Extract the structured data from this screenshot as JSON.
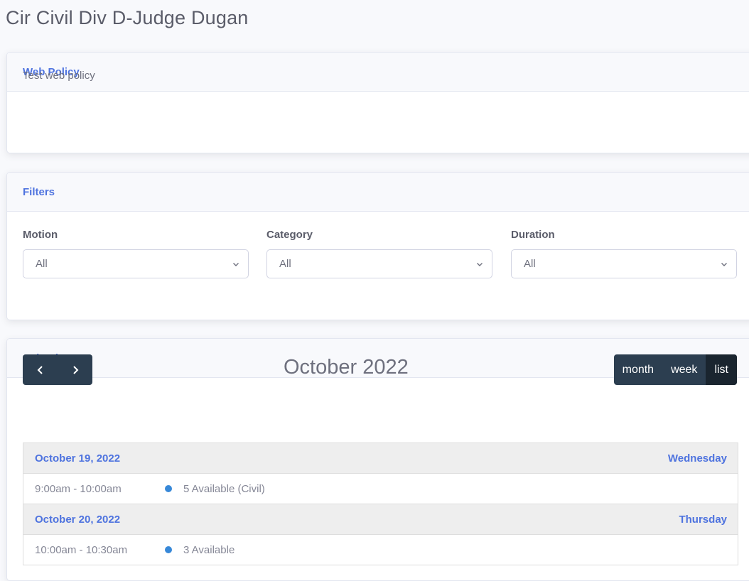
{
  "page": {
    "title": "Cir Civil Div D-Judge Dugan"
  },
  "policy": {
    "header": "Web Policy",
    "text": "Test web policy"
  },
  "filters": {
    "header": "Filters",
    "motion": {
      "label": "Motion",
      "value": "All"
    },
    "category": {
      "label": "Category",
      "value": "All"
    },
    "duration": {
      "label": "Duration",
      "value": "All"
    }
  },
  "calendar": {
    "header": "Calendar",
    "title": "October 2022",
    "views": [
      "month",
      "week",
      "list"
    ],
    "active_view": "list",
    "days": [
      {
        "date": "October 19, 2022",
        "weekday": "Wednesday",
        "events": [
          {
            "time": "9:00am - 10:00am",
            "title": "5 Available (Civil)"
          }
        ]
      },
      {
        "date": "October 20, 2022",
        "weekday": "Thursday",
        "events": [
          {
            "time": "10:00am - 10:30am",
            "title": "3 Available"
          }
        ]
      }
    ]
  },
  "colors": {
    "accent": "#4e73df",
    "toolbar": "#2c3e50",
    "toolbar_active": "#1a252f",
    "event_dot": "#3788d8"
  }
}
